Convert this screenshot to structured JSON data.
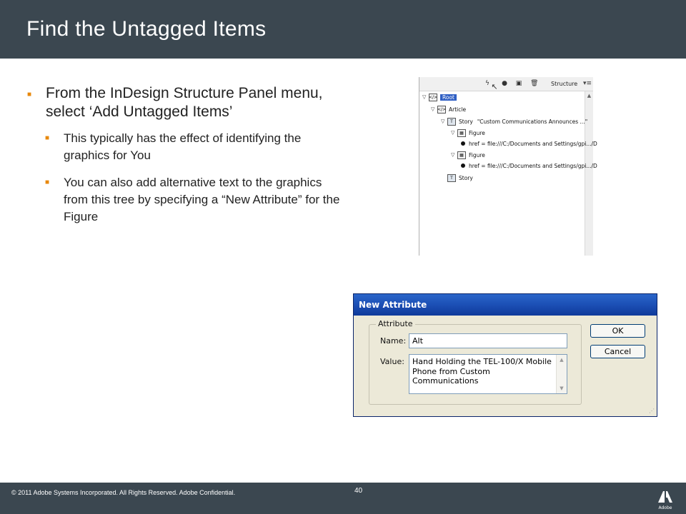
{
  "slide": {
    "title": "Find the Untagged Items",
    "footer_copyright": "© 2011 Adobe Systems Incorporated.  All Rights Reserved.  Adobe Confidential.",
    "page_number": "40",
    "logo_text": "Adobe"
  },
  "bullets": {
    "main": "From the InDesign Structure Panel menu, select ‘Add Untagged Items’",
    "sub1": "This typically has the effect of identifying the graphics for You",
    "sub2": "You can also add alternative text to the graphics from this tree by specifying a “New Attribute” for the Figure"
  },
  "structure_panel": {
    "tab_label": "Structure",
    "rows": {
      "root": "Root",
      "article": "Article",
      "story1_label": "Story",
      "story1_text": "\"Custom Communications Announces ...\"",
      "figure1": "Figure",
      "href1": "href = file:///C:/Documents and Settings/gpi.../D",
      "figure2": "Figure",
      "href2": "href = file:///C:/Documents and Settings/gpi.../D",
      "story2_label": "Story"
    }
  },
  "dialog": {
    "title": "New Attribute",
    "group_label": "Attribute",
    "name_label": "Name:",
    "name_value": "Alt",
    "value_label": "Value:",
    "value_text": "Hand Holding the TEL-100/X Mobile Phone from Custom Communications",
    "ok_label": "OK",
    "cancel_label": "Cancel"
  },
  "colors": {
    "header_bg": "#3b4750",
    "bullet_marker": "#e8880c",
    "dialog_title": "#1c4fb5"
  }
}
